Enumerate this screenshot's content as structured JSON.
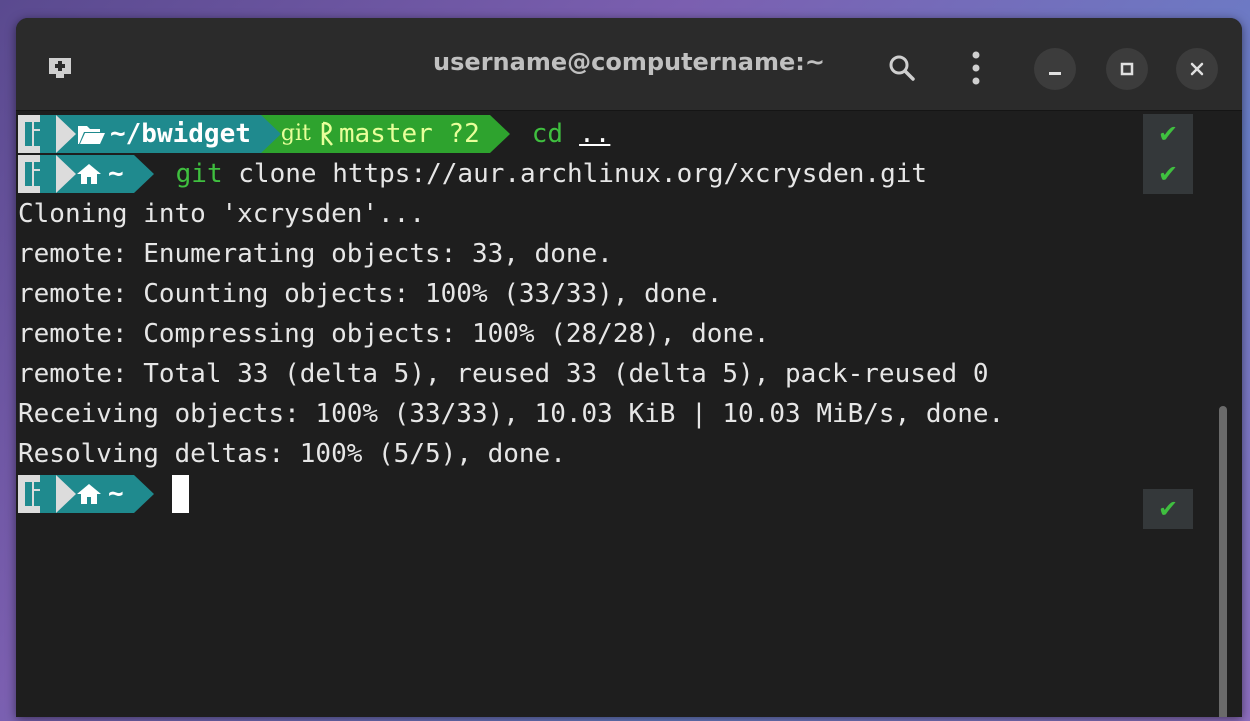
{
  "window": {
    "title": "username@computername:~"
  },
  "prompt1": {
    "dir": "~/bwidget",
    "git_label": "git",
    "branch": "master ?2",
    "command": "cd",
    "arg": ".."
  },
  "prompt2": {
    "dir": "~",
    "command": "git",
    "args": " clone https://aur.archlinux.org/xcrysden.git"
  },
  "output": [
    "Cloning into 'xcrysden'...",
    "remote: Enumerating objects: 33, done.",
    "remote: Counting objects: 100% (33/33), done.",
    "remote: Compressing objects: 100% (28/28), done.",
    "remote: Total 33 (delta 5), reused 33 (delta 5), pack-reused 0",
    "Receiving objects: 100% (33/33), 10.03 KiB | 10.03 MiB/s, done.",
    "Resolving deltas: 100% (5/5), done."
  ],
  "prompt3": {
    "dir": "~"
  },
  "status": {
    "ok": "✔"
  },
  "colors": {
    "teal": "#1f8a8e",
    "green": "#2ea32e",
    "background": "#1e1e1e"
  }
}
